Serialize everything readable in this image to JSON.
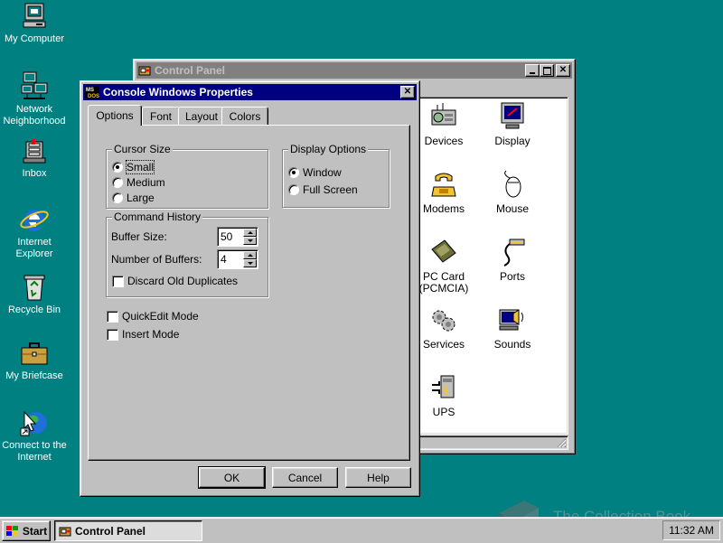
{
  "desktop": {
    "icons": [
      {
        "label": "My Computer",
        "icon": "computer-icon"
      },
      {
        "label": "Network Neighborhood",
        "icon": "network-icon"
      },
      {
        "label": "Inbox",
        "icon": "inbox-icon"
      },
      {
        "label": "Internet Explorer",
        "icon": "internet-explorer-icon"
      },
      {
        "label": "Recycle Bin",
        "icon": "recycle-bin-icon"
      },
      {
        "label": "My Briefcase",
        "icon": "briefcase-icon"
      },
      {
        "label": "Connect to the Internet",
        "icon": "connect-internet-icon"
      }
    ]
  },
  "control_panel": {
    "title": "Control Panel",
    "items": [
      {
        "label": "Devices",
        "icon": "devices-icon"
      },
      {
        "label": "Display",
        "icon": "display-icon"
      },
      {
        "label": "Modems",
        "icon": "modem-icon"
      },
      {
        "label": "Mouse",
        "icon": "mouse-icon"
      },
      {
        "label": "PC Card (PCMCIA)",
        "icon": "pc-card-icon"
      },
      {
        "label": "Ports",
        "icon": "ports-icon"
      },
      {
        "label": "Services",
        "icon": "services-icon"
      },
      {
        "label": "Sounds",
        "icon": "sounds-icon"
      },
      {
        "label": "UPS",
        "icon": "ups-icon"
      }
    ]
  },
  "dialog": {
    "title": "Console Windows Properties",
    "tabs": [
      "Options",
      "Font",
      "Layout",
      "Colors"
    ],
    "selected_tab": "Options",
    "cursor_size": {
      "legend": "Cursor Size",
      "options": [
        "Small",
        "Medium",
        "Large"
      ],
      "selected": "Small"
    },
    "display_options": {
      "legend": "Display Options",
      "options": [
        "Window",
        "Full Screen"
      ],
      "selected": "Window"
    },
    "command_history": {
      "legend": "Command History",
      "buffer_size_label": "Buffer Size:",
      "buffer_size_value": "50",
      "num_buffers_label": "Number of Buffers:",
      "num_buffers_value": "4",
      "discard_label": "Discard Old Duplicates",
      "discard_checked": false
    },
    "quickedit_label": "QuickEdit Mode",
    "quickedit_checked": false,
    "insert_label": "Insert Mode",
    "insert_checked": false,
    "buttons": {
      "ok": "OK",
      "cancel": "Cancel",
      "help": "Help"
    }
  },
  "taskbar": {
    "start_label": "Start",
    "tasks": [
      {
        "label": "Control Panel"
      }
    ],
    "clock": "11:32 AM"
  },
  "watermark": "The Collection Book",
  "colors": {
    "desktop": "#008080",
    "active_title": "#000080",
    "inactive_title": "#808080",
    "face": "#c0c0c0"
  }
}
